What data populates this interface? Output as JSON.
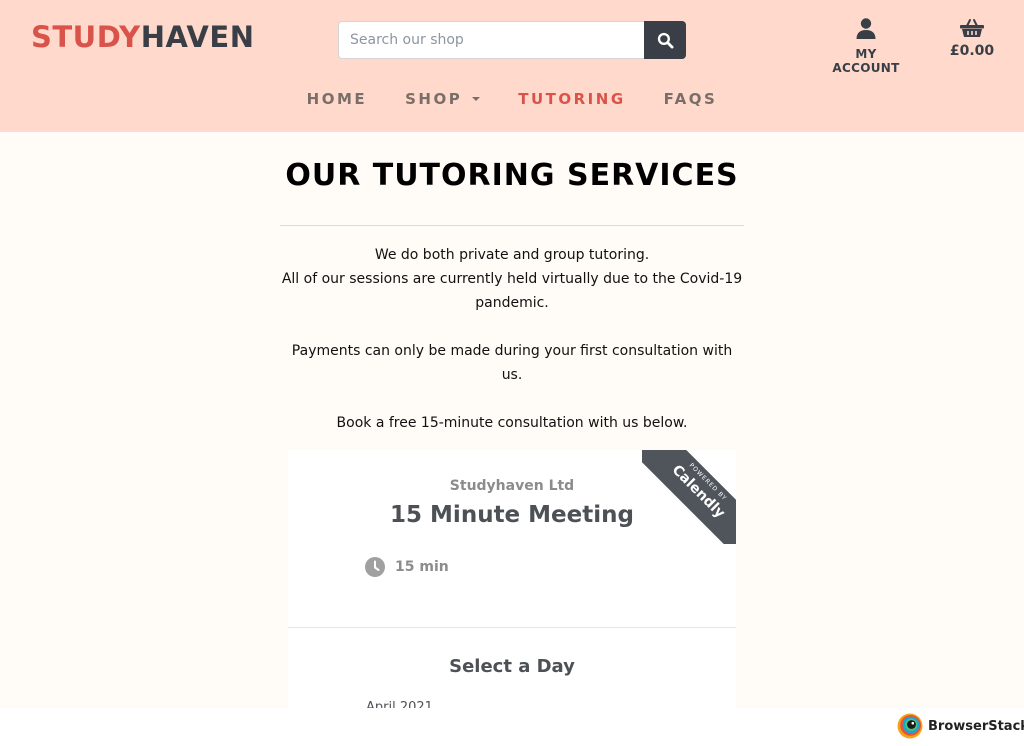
{
  "header": {
    "brand_part1": "STUDY",
    "brand_part2": "HAVEN",
    "search_placeholder": "Search our shop",
    "search_button_icon": "search-icon",
    "account_label": "MY ACCOUNT",
    "account_icon": "user-icon",
    "basket_total": "£0.00",
    "basket_icon": "basket-icon"
  },
  "nav": {
    "items": [
      {
        "label": "HOME",
        "active": false
      },
      {
        "label": "SHOP",
        "active": false,
        "has_dropdown": true
      },
      {
        "label": "TUTORING",
        "active": true
      },
      {
        "label": "FAQS",
        "active": false
      }
    ]
  },
  "main": {
    "title": "OUR TUTORING SERVICES",
    "intro_line1": "We do both private and group tutoring.",
    "intro_line2": "All of our sessions are currently held virtually due to the Covid-19 pandemic.",
    "intro_line3": "Payments can only be made during your first consultation with us.",
    "intro_line4": "Book a free 15-minute consultation with us below."
  },
  "calendly": {
    "organizer": "Studyhaven Ltd",
    "event_title": "15 Minute Meeting",
    "duration": "15 min",
    "duration_icon": "clock-icon",
    "ribbon_small": "POWERED BY",
    "ribbon_big": "Calendly",
    "select_day": "Select a Day",
    "month": "April 2021"
  },
  "footer_badge": {
    "name": "BrowserStack"
  },
  "colors": {
    "header_bg": "#ffd9cb",
    "brand_red": "#d9534a",
    "brand_dark": "#3a3f47",
    "page_bg": "#fffcf7"
  }
}
